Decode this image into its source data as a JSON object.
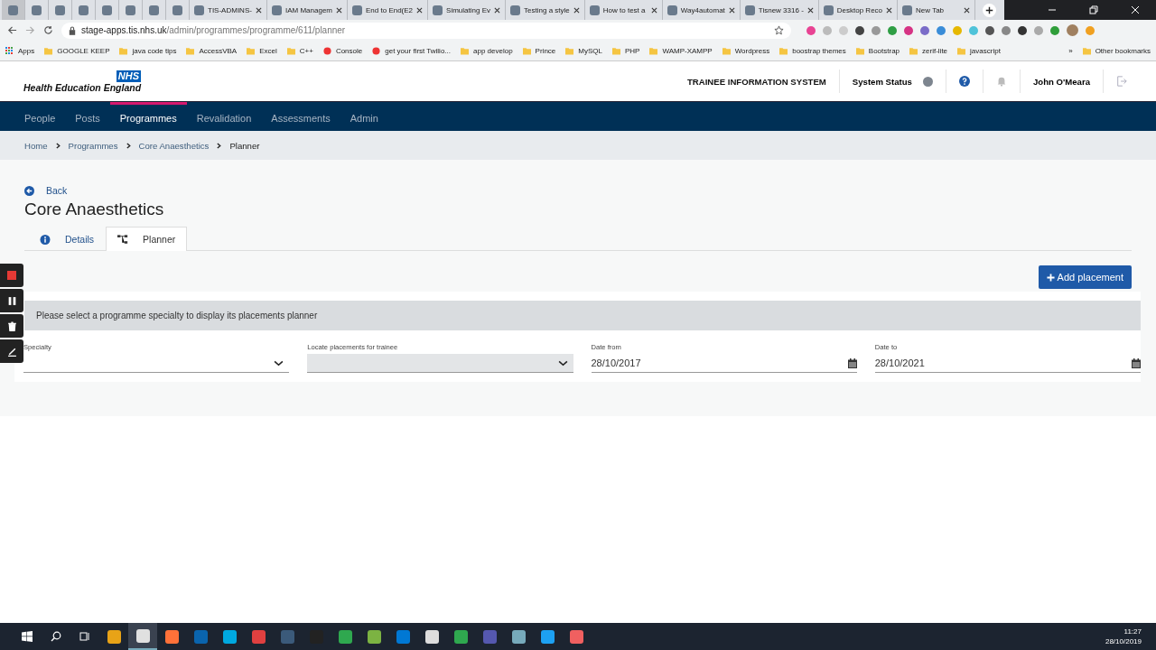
{
  "browser": {
    "tabs": [
      {
        "selected": true
      },
      {
        "selected": false
      },
      {
        "selected": false
      },
      {
        "selected": false
      },
      {
        "selected": false
      },
      {
        "selected": false
      },
      {
        "selected": false
      },
      {
        "selected": false
      },
      {
        "title": "TIS-ADMINS-",
        "selected": false
      },
      {
        "title": "IAM Managem",
        "selected": false
      },
      {
        "title": "End to End(E2",
        "selected": false
      },
      {
        "title": "Simulating Ev",
        "selected": false
      },
      {
        "title": "Testing a style",
        "selected": false
      },
      {
        "title": "How to test a",
        "selected": false
      },
      {
        "title": "Way4automat",
        "selected": false
      },
      {
        "title": "Tisnew 3316 -",
        "selected": false
      },
      {
        "title": "Desktop Reco",
        "selected": false
      },
      {
        "title": "New Tab",
        "selected": false
      }
    ],
    "address": {
      "host": "stage-apps.tis.nhs.uk",
      "path": "/admin/programmes/programme/611/planner"
    },
    "bookmarks": [
      {
        "label": "Apps",
        "kind": "apps"
      },
      {
        "label": "GOOGLE KEEP",
        "kind": "folder"
      },
      {
        "label": "java code tips",
        "kind": "folder"
      },
      {
        "label": "AccessVBA",
        "kind": "folder"
      },
      {
        "label": "Excel",
        "kind": "folder"
      },
      {
        "label": "C++",
        "kind": "folder"
      },
      {
        "label": "Console",
        "kind": "site"
      },
      {
        "label": "get your first Twilio...",
        "kind": "site"
      },
      {
        "label": "app develop",
        "kind": "folder"
      },
      {
        "label": "Prince",
        "kind": "folder"
      },
      {
        "label": "MySQL",
        "kind": "folder"
      },
      {
        "label": "PHP",
        "kind": "folder"
      },
      {
        "label": "WAMP-XAMPP",
        "kind": "folder"
      },
      {
        "label": "Wordpress",
        "kind": "folder"
      },
      {
        "label": "boostrap themes",
        "kind": "folder"
      },
      {
        "label": "Bootstrap",
        "kind": "folder"
      },
      {
        "label": "zerif-lite",
        "kind": "folder"
      },
      {
        "label": "javascript",
        "kind": "folder"
      }
    ],
    "bookmarks_overflow": "»",
    "other_bookmarks": "Other bookmarks"
  },
  "header": {
    "logo_badge": "NHS",
    "logo_text": "Health Education England",
    "system_name": "TRAINEE INFORMATION SYSTEM",
    "status_label": "System Status",
    "user": "John O'Meara"
  },
  "nav": [
    {
      "label": "People",
      "selected": false
    },
    {
      "label": "Posts",
      "selected": false
    },
    {
      "label": "Programmes",
      "selected": true
    },
    {
      "label": "Revalidation",
      "selected": false
    },
    {
      "label": "Assessments",
      "selected": false
    },
    {
      "label": "Admin",
      "selected": false
    }
  ],
  "breadcrumb": [
    "Home",
    "Programmes",
    "Core Anaesthetics",
    "Planner"
  ],
  "back": "Back",
  "title": "Core Anaesthetics",
  "page_tabs": [
    {
      "label": "Details",
      "kind": "info",
      "selected": false
    },
    {
      "label": "Planner",
      "kind": "tree",
      "selected": true
    }
  ],
  "add_button": "Add placement",
  "message": "Please select a programme specialty to display its placements planner",
  "fields": [
    {
      "label": "Specialty",
      "kind": "select",
      "disabled": false
    },
    {
      "label": "Locate placements for trainee",
      "kind": "select",
      "disabled": true
    },
    {
      "label": "Date from",
      "value": "28/10/2017",
      "kind": "date",
      "disabled": false
    },
    {
      "label": "Date to",
      "value": "28/10/2021",
      "kind": "date",
      "disabled": false
    }
  ],
  "taskbar": {
    "time": "11:27",
    "date": "28/10/2019"
  }
}
